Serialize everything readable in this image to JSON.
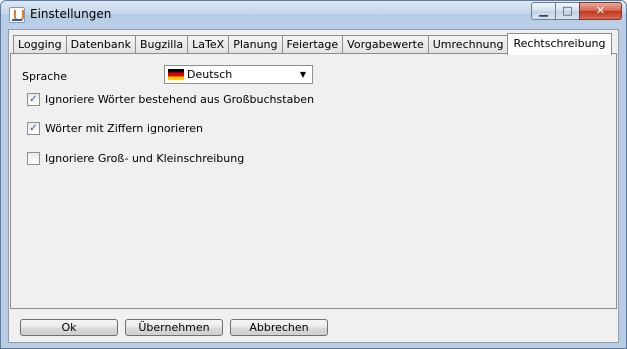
{
  "window": {
    "title": "Einstellungen",
    "minimize_glyph": "▁",
    "maximize_glyph": "□",
    "close_glyph": "✕"
  },
  "tabs": [
    {
      "label": "Logging",
      "active": false
    },
    {
      "label": "Datenbank",
      "active": false
    },
    {
      "label": "Bugzilla",
      "active": false
    },
    {
      "label": "LaTeX",
      "active": false
    },
    {
      "label": "Planung",
      "active": false
    },
    {
      "label": "Feiertage",
      "active": false
    },
    {
      "label": "Vorgabewerte",
      "active": false
    },
    {
      "label": "Umrechnung",
      "active": false
    },
    {
      "label": "Rechtschreibung",
      "active": true
    }
  ],
  "language": {
    "label": "Sprache",
    "selected": "Deutsch",
    "flag_icon": "germany-flag-icon"
  },
  "options": [
    {
      "label": "Ignoriere Wörter bestehend aus Großbuchstaben",
      "checked": true
    },
    {
      "label": "Wörter mit Ziffern ignorieren",
      "checked": true
    },
    {
      "label": "Ignoriere Groß- und Kleinschreibung",
      "checked": false
    }
  ],
  "buttons": {
    "ok": "Ok",
    "apply": "Übernehmen",
    "cancel": "Abbrechen"
  },
  "check_glyph": "✓",
  "dropdown_glyph": "▼"
}
